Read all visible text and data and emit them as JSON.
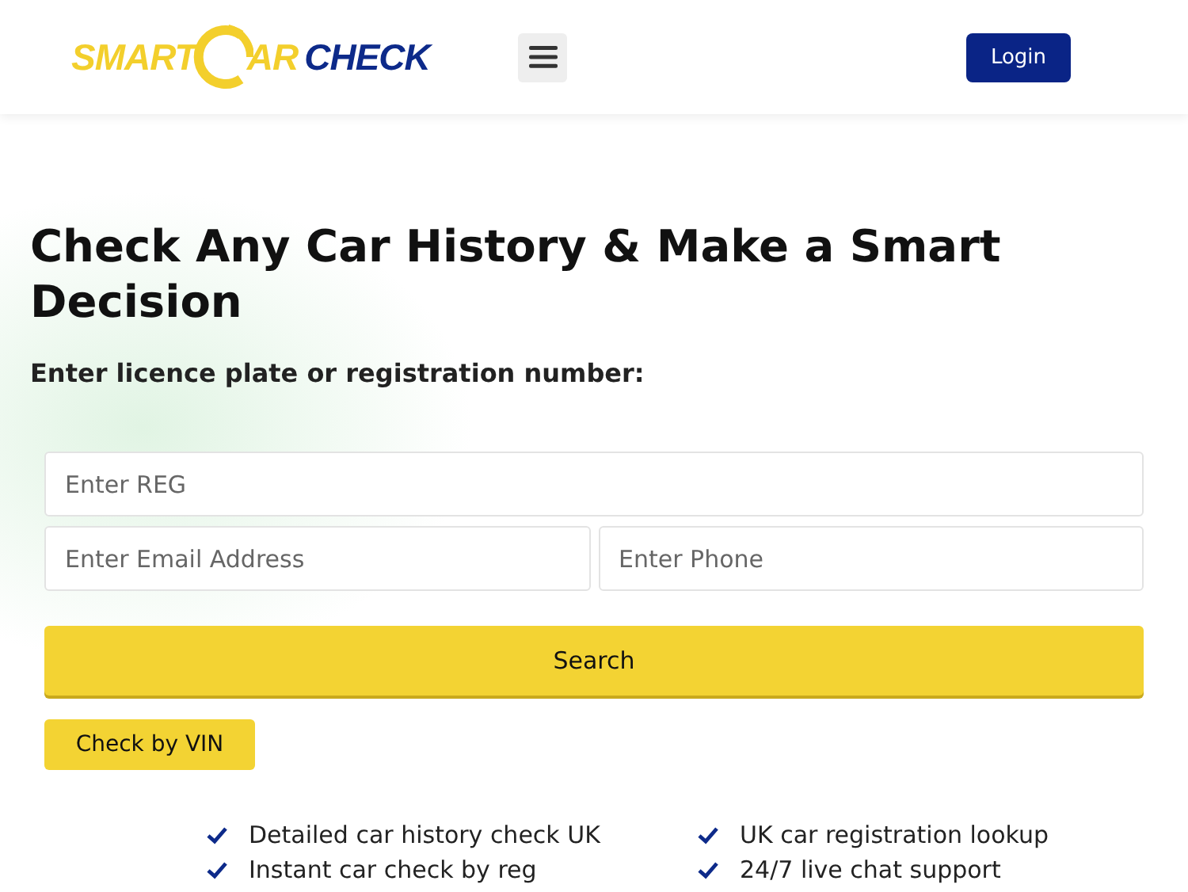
{
  "header": {
    "logo": {
      "part_1": "SMART",
      "part_2": "AR",
      "part_3": "CHECK"
    },
    "login_button": "Login"
  },
  "hero": {
    "title": "Check Any Car History & Make a Smart Decision",
    "subtitle": "Enter licence plate or registration number:"
  },
  "form": {
    "reg_field": {
      "placeholder": "Enter REG"
    },
    "email_field": {
      "placeholder": "Enter Email Address"
    },
    "phone_field": {
      "placeholder": "Enter Phone"
    },
    "search_button": "Search",
    "vin_button": "Check by VIN"
  },
  "features": [
    {
      "label": "Detailed car history check UK"
    },
    {
      "label": "UK car registration lookup"
    },
    {
      "label": "Instant car check by reg"
    },
    {
      "label": "24/7 live chat support"
    }
  ]
}
